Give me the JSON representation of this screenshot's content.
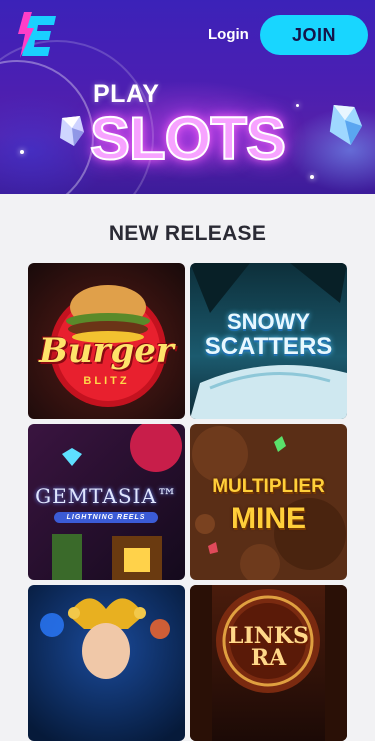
{
  "header": {
    "logo_icon": "lightning-e-logo",
    "login_label": "Login",
    "join_label": "JOIN"
  },
  "hero": {
    "line1": "PLAY",
    "line2": "SLOTS"
  },
  "section": {
    "title": "NEW RELEASE"
  },
  "games": [
    {
      "line1": "Burger",
      "line2": "BLITZ"
    },
    {
      "line1": "SNOWY",
      "line2": "SCATTERS"
    },
    {
      "line1": "GEMTASIA™",
      "line2": "LIGHTNING REELS"
    },
    {
      "line1": "MULTIPLIER",
      "line2": "MINE"
    },
    {
      "line1": "",
      "line2": ""
    },
    {
      "line1": "LINKS",
      "line2": "RA"
    }
  ],
  "colors": {
    "join_bg": "#18d6ff",
    "hero_bg": "#4a1fb3",
    "slots_pink": "#f7a3ff"
  }
}
